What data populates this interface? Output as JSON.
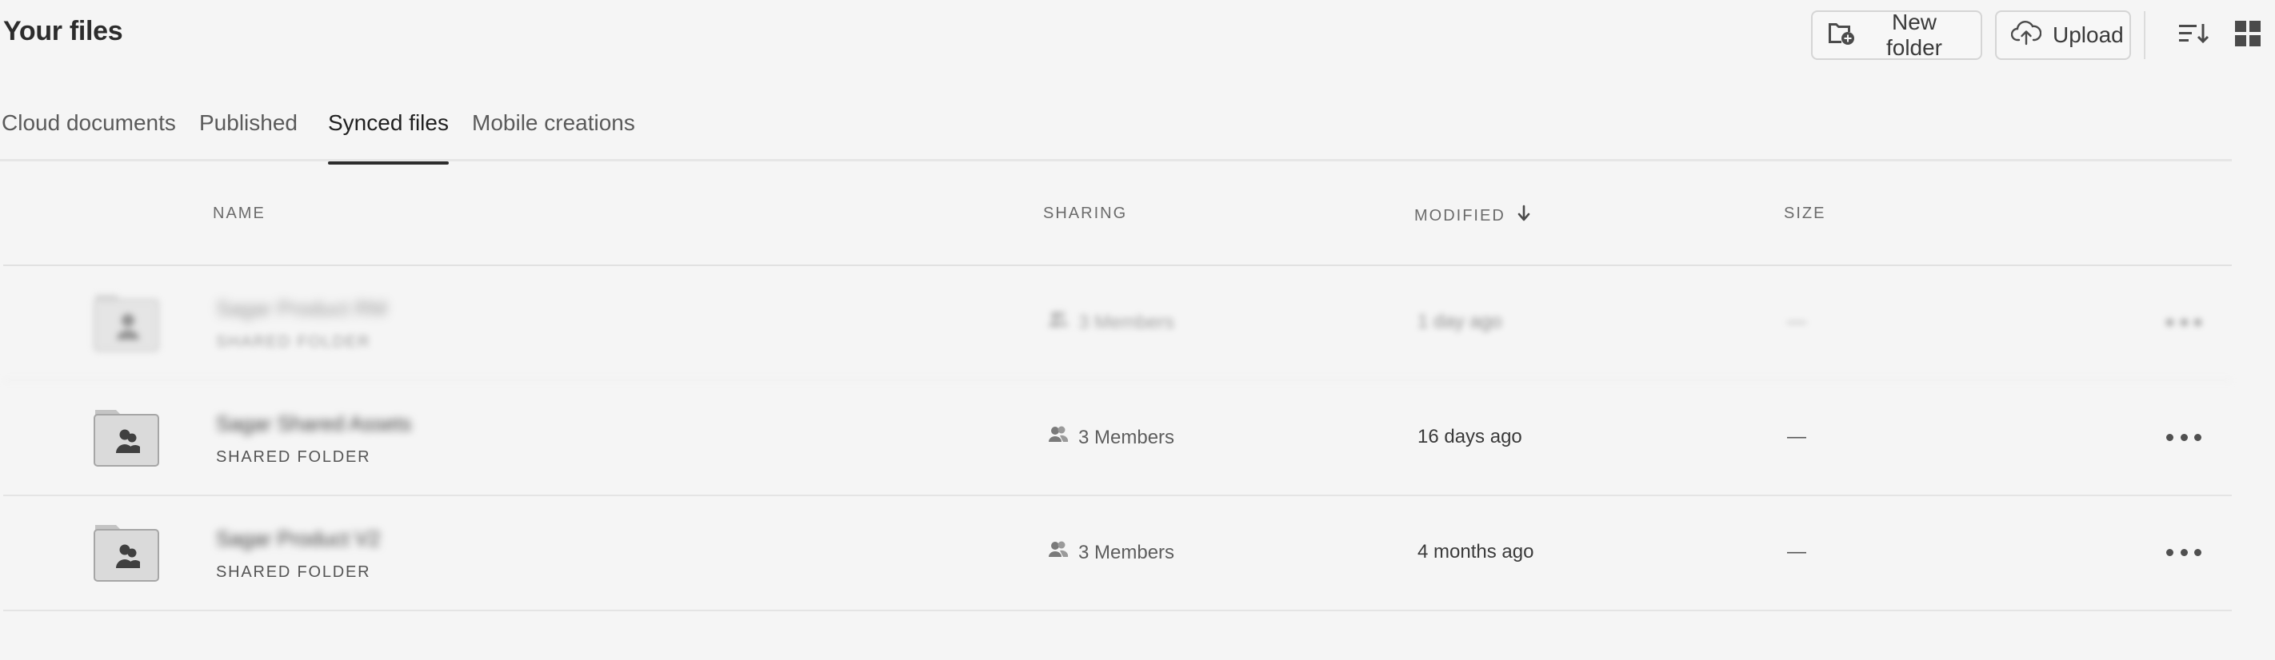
{
  "header": {
    "title": "Your files",
    "new_folder_label": "New folder",
    "upload_label": "Upload"
  },
  "tabs": [
    {
      "label": "Cloud documents",
      "active": false
    },
    {
      "label": "Published",
      "active": false
    },
    {
      "label": "Synced files",
      "active": true
    },
    {
      "label": "Mobile creations",
      "active": false
    }
  ],
  "table": {
    "columns": {
      "name": "NAME",
      "sharing": "SHARING",
      "modified": "MODIFIED",
      "size": "SIZE"
    },
    "sort": {
      "column": "modified",
      "direction": "descending"
    },
    "rows": [
      {
        "name": "Sagar Product RM",
        "type": "SHARED FOLDER",
        "sharing": "3 Members",
        "modified": "1 day ago",
        "size": "—",
        "blurred": true
      },
      {
        "name": "Sagar Shared Assets",
        "type": "SHARED FOLDER",
        "sharing": "3 Members",
        "modified": "16 days ago",
        "size": "—",
        "blurred": false
      },
      {
        "name": "Sagar Product V2",
        "type": "SHARED FOLDER",
        "sharing": "3 Members",
        "modified": "4 months ago",
        "size": "—",
        "blurred": false
      }
    ]
  },
  "icons": {
    "new_folder": "folder-plus-icon",
    "upload": "cloud-upload-icon",
    "sort": "sort-list-icon",
    "view": "grid-view-icon",
    "sort_arrow": "arrow-down-icon",
    "members": "members-icon",
    "more": "more-horizontal-icon",
    "thumbnail": "shared-folder-icon"
  },
  "colors": {
    "background": "#f5f5f5",
    "text": "#2c2c2c",
    "border": "#e4e4e4"
  }
}
